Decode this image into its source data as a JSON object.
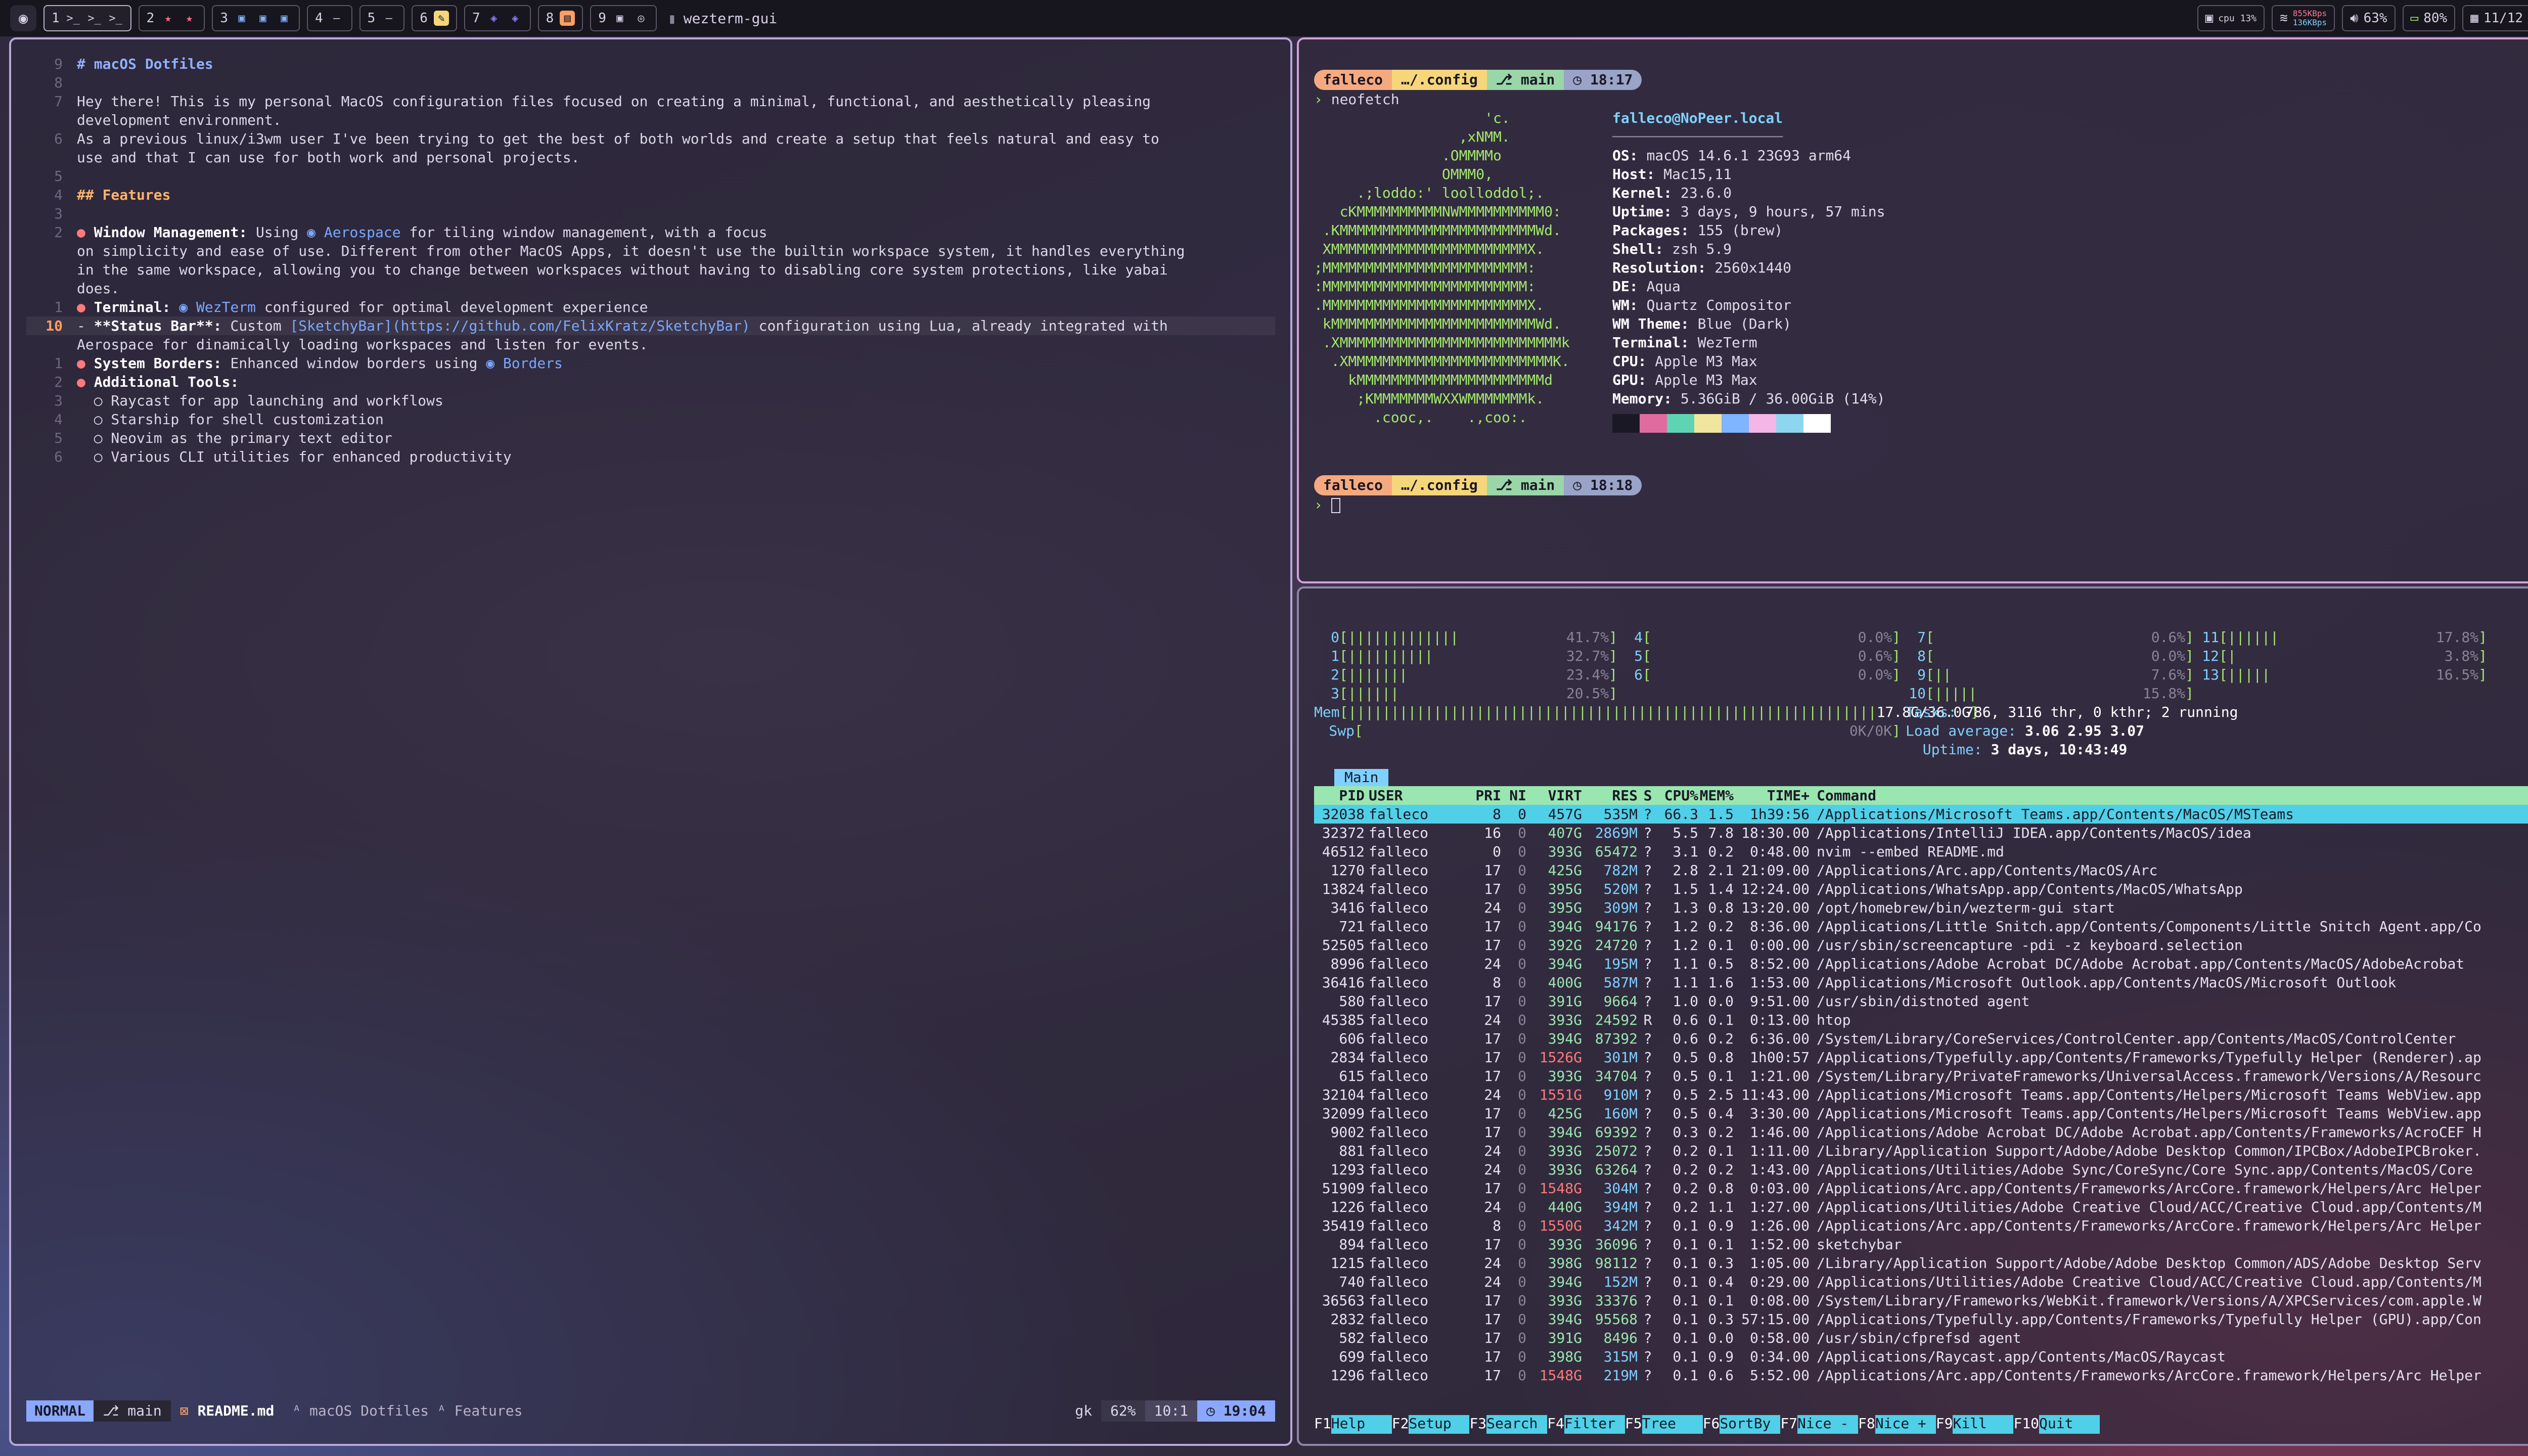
{
  "menubar": {
    "workspaces": [
      {
        "num": "1",
        "icons": [
          "terminal-icon",
          "terminal-icon",
          "terminal-icon"
        ],
        "glyphs": [
          ">_",
          ">_",
          ">_"
        ],
        "active": true
      },
      {
        "num": "2",
        "icons": [
          "star-icon",
          "star-icon"
        ],
        "glyphs": [
          "★",
          "★"
        ],
        "active": false
      },
      {
        "num": "3",
        "icons": [
          "app-icon",
          "app-icon",
          "app-icon"
        ],
        "glyphs": [
          "▣",
          "▣",
          "▣"
        ],
        "active": false
      },
      {
        "num": "4",
        "icons": [],
        "glyphs": [
          "—"
        ],
        "active": false
      },
      {
        "num": "5",
        "icons": [],
        "glyphs": [
          "—"
        ],
        "active": false
      },
      {
        "num": "6",
        "icons": [
          "notes-icon"
        ],
        "glyphs": [
          "✎"
        ],
        "active": false
      },
      {
        "num": "7",
        "icons": [
          "teams-icon",
          "teams-icon"
        ],
        "glyphs": [
          "◈",
          "◈"
        ],
        "active": false
      },
      {
        "num": "8",
        "icons": [
          "folder-icon"
        ],
        "glyphs": [
          "▤"
        ],
        "active": false
      },
      {
        "num": "9",
        "icons": [
          "app-icon",
          "whatsapp-icon"
        ],
        "glyphs": [
          "▣",
          "◎"
        ],
        "active": false
      }
    ],
    "active_app": "wezterm-gui",
    "cpu": "cpu 13%",
    "net_up": "855KBps",
    "net_down": "136KBps",
    "volume": "63%",
    "battery": "80%",
    "clock": "11/12 19:04"
  },
  "nvim": {
    "lines": [
      {
        "n": "9",
        "parts": [
          {
            "t": "# macOS Dotfiles",
            "c": "h1"
          }
        ]
      },
      {
        "n": "8",
        "parts": [
          {
            "t": "",
            "c": ""
          }
        ]
      },
      {
        "n": "7",
        "parts": [
          {
            "t": "Hey there! This is my personal MacOS configuration files focused on creating a minimal, functional, and aesthetically pleasing",
            "c": ""
          }
        ]
      },
      {
        "n": "",
        "parts": [
          {
            "t": "development environment.",
            "c": ""
          }
        ]
      },
      {
        "n": "6",
        "parts": [
          {
            "t": "As a previous linux/i3wm user I've been trying to get the best of both worlds and create a setup that feels natural and easy to",
            "c": ""
          }
        ]
      },
      {
        "n": "",
        "parts": [
          {
            "t": "use and that I can use for both work and personal projects.",
            "c": ""
          }
        ]
      },
      {
        "n": "5",
        "parts": [
          {
            "t": "",
            "c": ""
          }
        ]
      },
      {
        "n": "4",
        "parts": [
          {
            "t": "## Features",
            "c": "h2"
          }
        ]
      },
      {
        "n": "3",
        "parts": [
          {
            "t": "",
            "c": ""
          }
        ]
      },
      {
        "n": "2",
        "parts": [
          {
            "t": "● ",
            "c": "bul"
          },
          {
            "t": "Window Management:",
            "c": "bold"
          },
          {
            "t": " Using ",
            "c": ""
          },
          {
            "t": "◉ Aerospace",
            "c": "link"
          },
          {
            "t": " for tiling window management, with a focus",
            "c": ""
          }
        ]
      },
      {
        "n": "",
        "parts": [
          {
            "t": "on simplicity and ease of use. Different from other MacOS Apps, it doesn't use the builtin workspace system, it handles everything",
            "c": ""
          }
        ]
      },
      {
        "n": "",
        "parts": [
          {
            "t": "in the same workspace, allowing you to change between workspaces without having to disabling core system protections, like yabai",
            "c": ""
          }
        ]
      },
      {
        "n": "",
        "parts": [
          {
            "t": "does.",
            "c": ""
          }
        ]
      },
      {
        "n": "1",
        "parts": [
          {
            "t": "● ",
            "c": "bul"
          },
          {
            "t": "Terminal:",
            "c": "bold"
          },
          {
            "t": " ",
            "c": ""
          },
          {
            "t": "◉ WezTerm",
            "c": "link"
          },
          {
            "t": " configured for optimal development experience",
            "c": ""
          }
        ]
      },
      {
        "n": "10",
        "cur": true,
        "parts": [
          {
            "t": "- ",
            "c": ""
          },
          {
            "t": "**Status Bar**:",
            "c": "bold"
          },
          {
            "t": " Custom ",
            "c": ""
          },
          {
            "t": "[SketchyBar](https://github.com/FelixKratz/SketchyBar)",
            "c": "link"
          },
          {
            "t": " configuration using Lua, already integrated with",
            "c": ""
          }
        ]
      },
      {
        "n": "",
        "parts": [
          {
            "t": "Aerospace for dinamically loading workspaces and listen for events.",
            "c": ""
          }
        ]
      },
      {
        "n": "1",
        "parts": [
          {
            "t": "● ",
            "c": "bul"
          },
          {
            "t": "System Borders:",
            "c": "bold"
          },
          {
            "t": " Enhanced window borders using ",
            "c": ""
          },
          {
            "t": "◉ Borders",
            "c": "link"
          }
        ]
      },
      {
        "n": "2",
        "parts": [
          {
            "t": "● ",
            "c": "bul"
          },
          {
            "t": "Additional Tools:",
            "c": "bold"
          }
        ]
      },
      {
        "n": "3",
        "parts": [
          {
            "t": "  ○ Raycast for app launching and workflows",
            "c": ""
          }
        ]
      },
      {
        "n": "4",
        "parts": [
          {
            "t": "  ○ Starship for shell customization",
            "c": ""
          }
        ]
      },
      {
        "n": "5",
        "parts": [
          {
            "t": "  ○ Neovim as the primary text editor",
            "c": ""
          }
        ]
      },
      {
        "n": "6",
        "parts": [
          {
            "t": "  ○ Various CLI utilities for enhanced productivity",
            "c": ""
          }
        ]
      }
    ],
    "status": {
      "mode": "NORMAL",
      "branch": "main",
      "file": "README.md",
      "crumb1": "macOS Dotfiles",
      "crumb2": "Features",
      "ft": "gk",
      "percent": "62%",
      "position": "10:1",
      "time": "19:04"
    }
  },
  "neofetch": {
    "prompt1": {
      "user": "falleco",
      "dir": "…/.config",
      "branch": "main",
      "time": "18:17"
    },
    "command": "neofetch",
    "logo": [
      "                    'c.",
      "                 ,xNMM.",
      "               .OMMMMo",
      "               OMMM0,",
      "     .;loddo:' loolloddol;.",
      "   cKMMMMMMMMMMNWMMMMMMMMMM0:",
      " .KMMMMMMMMMMMMMMMMMMMMMMMWd.",
      " XMMMMMMMMMMMMMMMMMMMMMMMX.",
      ";MMMMMMMMMMMMMMMMMMMMMMMM:",
      ":MMMMMMMMMMMMMMMMMMMMMMMM:",
      ".MMMMMMMMMMMMMMMMMMMMMMMMX.",
      " kMMMMMMMMMMMMMMMMMMMMMMMMWd.",
      " .XMMMMMMMMMMMMMMMMMMMMMMMMMMk",
      "  .XMMMMMMMMMMMMMMMMMMMMMMMMK.",
      "    kMMMMMMMMMMMMMMMMMMMMMMd",
      "     ;KMMMMMMMWXXWMMMMMMMk.",
      "       .cooc,.    .,coo:."
    ],
    "header": "falleco@NoPeer.local",
    "info": [
      {
        "k": "OS",
        "v": "macOS 14.6.1 23G93 arm64"
      },
      {
        "k": "Host",
        "v": "Mac15,11"
      },
      {
        "k": "Kernel",
        "v": "23.6.0"
      },
      {
        "k": "Uptime",
        "v": "3 days, 9 hours, 57 mins"
      },
      {
        "k": "Packages",
        "v": "155 (brew)"
      },
      {
        "k": "Shell",
        "v": "zsh 5.9"
      },
      {
        "k": "Resolution",
        "v": "2560x1440"
      },
      {
        "k": "DE",
        "v": "Aqua"
      },
      {
        "k": "WM",
        "v": "Quartz Compositor"
      },
      {
        "k": "WM Theme",
        "v": "Blue (Dark)"
      },
      {
        "k": "Terminal",
        "v": "WezTerm"
      },
      {
        "k": "CPU",
        "v": "Apple M3 Max"
      },
      {
        "k": "GPU",
        "v": "Apple M3 Max"
      },
      {
        "k": "Memory",
        "v": "5.36GiB / 36.00GiB (14%)"
      }
    ],
    "swatches": [
      "#1b1826",
      "#e06c9f",
      "#5fd4b4",
      "#f0e6a0",
      "#7fb4ff",
      "#f3b6e6",
      "#8ed6f0",
      "#ffffff"
    ],
    "prompt2": {
      "user": "falleco",
      "dir": "…/.config",
      "branch": "main",
      "time": "18:18"
    }
  },
  "htop": {
    "cpus": [
      {
        "n": "0",
        "v": "41.7%"
      },
      {
        "n": "1",
        "v": "32.7%"
      },
      {
        "n": "2",
        "v": "23.4%"
      },
      {
        "n": "3",
        "v": "20.5%"
      },
      {
        "n": "4",
        "v": "0.0%"
      },
      {
        "n": "5",
        "v": "0.6%"
      },
      {
        "n": "6",
        "v": "0.0%"
      },
      {
        "n": "7",
        "v": "0.6%"
      },
      {
        "n": "8",
        "v": "0.0%"
      },
      {
        "n": "9",
        "v": "7.6%"
      },
      {
        "n": "10",
        "v": "15.8%"
      },
      {
        "n": "11",
        "v": "17.8%"
      },
      {
        "n": "12",
        "v": "3.8%"
      },
      {
        "n": "13",
        "v": "16.5%"
      }
    ],
    "mem": "17.8G/36.0G",
    "swp": "0K/0K",
    "tasks_label": "Tasks:",
    "tasks": "786, 3116 thr, 0 kthr; 2 running",
    "load_label": "Load average:",
    "load": "3.06 2.95 3.07",
    "uptime_label": "Uptime:",
    "uptime": "3 days, 10:43:49",
    "tab": "Main",
    "columns": [
      "PID",
      "USER",
      "PRI",
      "NI",
      "VIRT",
      "RES",
      "S",
      "CPU%",
      "MEM%",
      "TIME+",
      "Command"
    ],
    "rows": [
      [
        "32038",
        "falleco",
        "8",
        "0",
        "457G",
        "535M",
        "?",
        "66.3",
        "1.5",
        "1h39:56",
        "/Applications/Microsoft Teams.app/Contents/MacOS/MSTeams"
      ],
      [
        "32372",
        "falleco",
        "16",
        "0",
        "407G",
        "2869M",
        "?",
        "5.5",
        "7.8",
        "18:30.00",
        "/Applications/IntelliJ IDEA.app/Contents/MacOS/idea"
      ],
      [
        "46512",
        "falleco",
        "0",
        "0",
        "393G",
        "65472",
        "?",
        "3.1",
        "0.2",
        "0:48.00",
        "nvim --embed README.md"
      ],
      [
        "1270",
        "falleco",
        "17",
        "0",
        "425G",
        "782M",
        "?",
        "2.8",
        "2.1",
        "21:09.00",
        "/Applications/Arc.app/Contents/MacOS/Arc"
      ],
      [
        "13824",
        "falleco",
        "17",
        "0",
        "395G",
        "520M",
        "?",
        "1.5",
        "1.4",
        "12:24.00",
        "/Applications/WhatsApp.app/Contents/MacOS/WhatsApp"
      ],
      [
        "3416",
        "falleco",
        "24",
        "0",
        "395G",
        "309M",
        "?",
        "1.3",
        "0.8",
        "13:20.00",
        "/opt/homebrew/bin/wezterm-gui start"
      ],
      [
        "721",
        "falleco",
        "17",
        "0",
        "394G",
        "94176",
        "?",
        "1.2",
        "0.2",
        "8:36.00",
        "/Applications/Little Snitch.app/Contents/Components/Little Snitch Agent.app/Co"
      ],
      [
        "52505",
        "falleco",
        "17",
        "0",
        "392G",
        "24720",
        "?",
        "1.2",
        "0.1",
        "0:00.00",
        "/usr/sbin/screencapture -pdi -z keyboard.selection"
      ],
      [
        "8996",
        "falleco",
        "24",
        "0",
        "394G",
        "195M",
        "?",
        "1.1",
        "0.5",
        "8:52.00",
        "/Applications/Adobe Acrobat DC/Adobe Acrobat.app/Contents/MacOS/AdobeAcrobat"
      ],
      [
        "36416",
        "falleco",
        "8",
        "0",
        "400G",
        "587M",
        "?",
        "1.1",
        "1.6",
        "1:53.00",
        "/Applications/Microsoft Outlook.app/Contents/MacOS/Microsoft Outlook"
      ],
      [
        "580",
        "falleco",
        "17",
        "0",
        "391G",
        "9664",
        "?",
        "1.0",
        "0.0",
        "9:51.00",
        "/usr/sbin/distnoted agent"
      ],
      [
        "45385",
        "falleco",
        "24",
        "0",
        "393G",
        "24592",
        "R",
        "0.6",
        "0.1",
        "0:13.00",
        "htop"
      ],
      [
        "606",
        "falleco",
        "17",
        "0",
        "394G",
        "87392",
        "?",
        "0.6",
        "0.2",
        "6:36.00",
        "/System/Library/CoreServices/ControlCenter.app/Contents/MacOS/ControlCenter"
      ],
      [
        "2834",
        "falleco",
        "17",
        "0",
        "1526G",
        "301M",
        "?",
        "0.5",
        "0.8",
        "1h00:57",
        "/Applications/Typefully.app/Contents/Frameworks/Typefully Helper (Renderer).ap"
      ],
      [
        "615",
        "falleco",
        "17",
        "0",
        "393G",
        "34704",
        "?",
        "0.5",
        "0.1",
        "1:21.00",
        "/System/Library/PrivateFrameworks/UniversalAccess.framework/Versions/A/Resourc"
      ],
      [
        "32104",
        "falleco",
        "24",
        "0",
        "1551G",
        "910M",
        "?",
        "0.5",
        "2.5",
        "11:43.00",
        "/Applications/Microsoft Teams.app/Contents/Helpers/Microsoft Teams WebView.app"
      ],
      [
        "32099",
        "falleco",
        "17",
        "0",
        "425G",
        "160M",
        "?",
        "0.5",
        "0.4",
        "3:30.00",
        "/Applications/Microsoft Teams.app/Contents/Helpers/Microsoft Teams WebView.app"
      ],
      [
        "9002",
        "falleco",
        "17",
        "0",
        "394G",
        "69392",
        "?",
        "0.3",
        "0.2",
        "1:46.00",
        "/Applications/Adobe Acrobat DC/Adobe Acrobat.app/Contents/Frameworks/AcroCEF H"
      ],
      [
        "881",
        "falleco",
        "24",
        "0",
        "393G",
        "25072",
        "?",
        "0.2",
        "0.1",
        "1:11.00",
        "/Library/Application Support/Adobe/Adobe Desktop Common/IPCBox/AdobeIPCBroker."
      ],
      [
        "1293",
        "falleco",
        "24",
        "0",
        "393G",
        "63264",
        "?",
        "0.2",
        "0.2",
        "1:43.00",
        "/Applications/Utilities/Adobe Sync/CoreSync/Core Sync.app/Contents/MacOS/Core"
      ],
      [
        "51909",
        "falleco",
        "17",
        "0",
        "1548G",
        "304M",
        "?",
        "0.2",
        "0.8",
        "0:03.00",
        "/Applications/Arc.app/Contents/Frameworks/ArcCore.framework/Helpers/Arc Helper"
      ],
      [
        "1226",
        "falleco",
        "24",
        "0",
        "440G",
        "394M",
        "?",
        "0.2",
        "1.1",
        "1:27.00",
        "/Applications/Utilities/Adobe Creative Cloud/ACC/Creative Cloud.app/Contents/M"
      ],
      [
        "35419",
        "falleco",
        "8",
        "0",
        "1550G",
        "342M",
        "?",
        "0.1",
        "0.9",
        "1:26.00",
        "/Applications/Arc.app/Contents/Frameworks/ArcCore.framework/Helpers/Arc Helper"
      ],
      [
        "894",
        "falleco",
        "17",
        "0",
        "393G",
        "36096",
        "?",
        "0.1",
        "0.1",
        "1:52.00",
        "sketchybar"
      ],
      [
        "1215",
        "falleco",
        "24",
        "0",
        "398G",
        "98112",
        "?",
        "0.1",
        "0.3",
        "1:05.00",
        "/Library/Application Support/Adobe/Adobe Desktop Common/ADS/Adobe Desktop Serv"
      ],
      [
        "740",
        "falleco",
        "24",
        "0",
        "394G",
        "152M",
        "?",
        "0.1",
        "0.4",
        "0:29.00",
        "/Applications/Utilities/Adobe Creative Cloud/ACC/Creative Cloud.app/Contents/M"
      ],
      [
        "36563",
        "falleco",
        "17",
        "0",
        "393G",
        "33376",
        "?",
        "0.1",
        "0.1",
        "0:08.00",
        "/System/Library/Frameworks/WebKit.framework/Versions/A/XPCServices/com.apple.W"
      ],
      [
        "2832",
        "falleco",
        "17",
        "0",
        "394G",
        "95568",
        "?",
        "0.1",
        "0.3",
        "57:15.00",
        "/Applications/Typefully.app/Contents/Frameworks/Typefully Helper (GPU).app/Con"
      ],
      [
        "582",
        "falleco",
        "17",
        "0",
        "391G",
        "8496",
        "?",
        "0.1",
        "0.0",
        "0:58.00",
        "/usr/sbin/cfprefsd agent"
      ],
      [
        "699",
        "falleco",
        "17",
        "0",
        "398G",
        "315M",
        "?",
        "0.1",
        "0.9",
        "0:34.00",
        "/Applications/Raycast.app/Contents/MacOS/Raycast"
      ],
      [
        "1296",
        "falleco",
        "17",
        "0",
        "1548G",
        "219M",
        "?",
        "0.1",
        "0.6",
        "5:52.00",
        "/Applications/Arc.app/Contents/Frameworks/ArcCore.framework/Helpers/Arc Helper"
      ]
    ],
    "fkeys": [
      {
        "k": "F1",
        "l": "Help"
      },
      {
        "k": "F2",
        "l": "Setup"
      },
      {
        "k": "F3",
        "l": "Search"
      },
      {
        "k": "F4",
        "l": "Filter"
      },
      {
        "k": "F5",
        "l": "Tree"
      },
      {
        "k": "F6",
        "l": "SortBy"
      },
      {
        "k": "F7",
        "l": "Nice -"
      },
      {
        "k": "F8",
        "l": "Nice +"
      },
      {
        "k": "F9",
        "l": "Kill"
      },
      {
        "k": "F10",
        "l": "Quit"
      }
    ]
  }
}
